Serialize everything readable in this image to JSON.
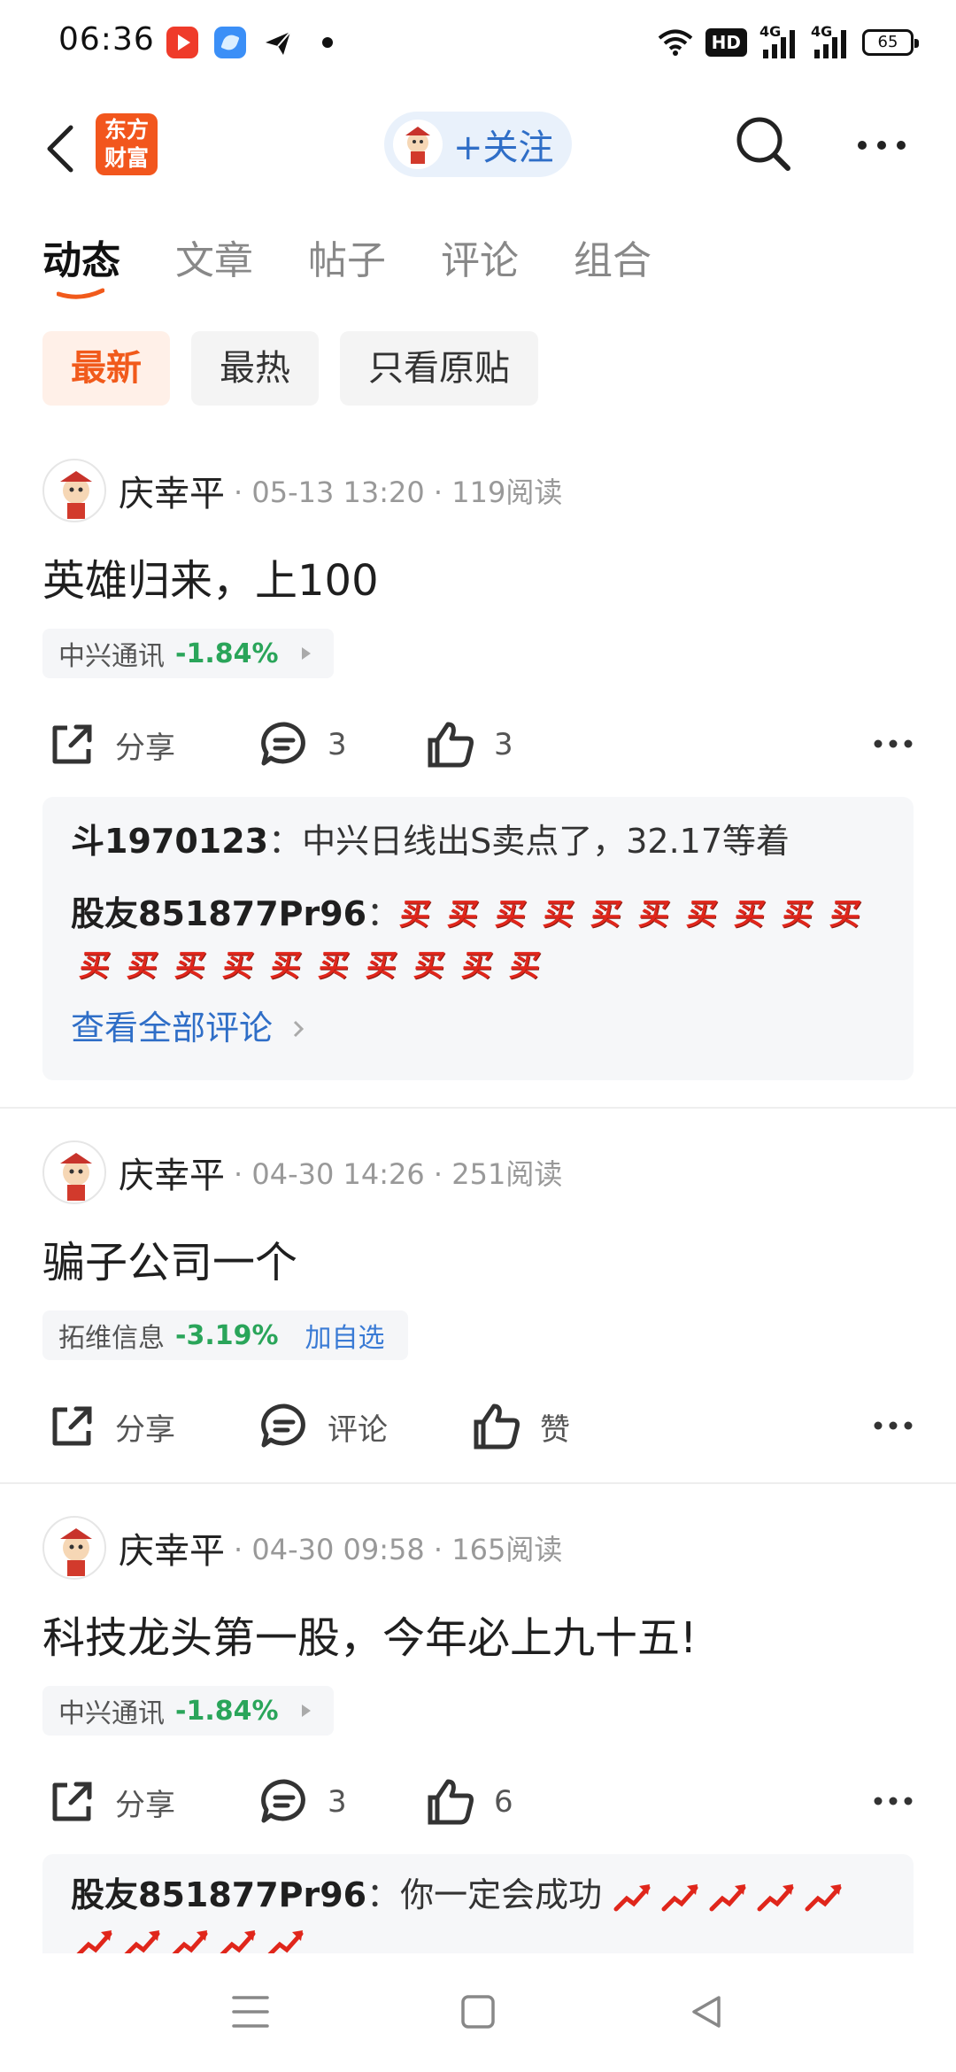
{
  "status_bar": {
    "time": "06:36",
    "hd_label": "HD",
    "net1": "4G",
    "net2": "4G",
    "battery": "65"
  },
  "nav": {
    "logo_line1": "东方",
    "logo_line2": "财富",
    "follow_label": "+关注"
  },
  "tabs": [
    "动态",
    "文章",
    "帖子",
    "评论",
    "组合"
  ],
  "filters": [
    "最新",
    "最热",
    "只看原贴"
  ],
  "posts": [
    {
      "author": "庆幸平",
      "meta": "· 05-13 13:20 · 119阅读",
      "text": "英雄归来，上100",
      "stock_name": "中兴通讯",
      "stock_change": "-1.84%",
      "share": "分享",
      "comments": "3",
      "likes": "3",
      "comment1_user": "斗1970123",
      "comment1_text": "：中兴日线出S卖点了，32.17等着",
      "comment2_user": "股友851877Pr96",
      "comment2_text": "：",
      "comment2_emoji": "买",
      "see_all": "查看全部评论"
    },
    {
      "author": "庆幸平",
      "meta": "· 04-30 14:26 · 251阅读",
      "text": "骗子公司一个",
      "stock_name": "拓维信息",
      "stock_change": "-3.19%",
      "stock_add": "加自选",
      "share": "分享",
      "comments": "评论",
      "likes": "赞"
    },
    {
      "author": "庆幸平",
      "meta": "· 04-30 09:58 · 165阅读",
      "text": "科技龙头第一股，今年必上九十五!",
      "stock_name": "中兴通讯",
      "stock_change": "-1.84%",
      "share": "分享",
      "comments": "3",
      "likes": "6",
      "comment1_user": "股友851877Pr96",
      "comment1_text": "：你一定会成功"
    }
  ],
  "colors": {
    "accent": "#f15a1b",
    "link": "#2f6ec7",
    "down": "#2aa55a"
  },
  "icons": [
    "back-icon",
    "search-icon",
    "more-icon",
    "share-icon",
    "comment-icon",
    "like-icon",
    "menu-icon",
    "home-icon",
    "back-triangle-icon"
  ]
}
